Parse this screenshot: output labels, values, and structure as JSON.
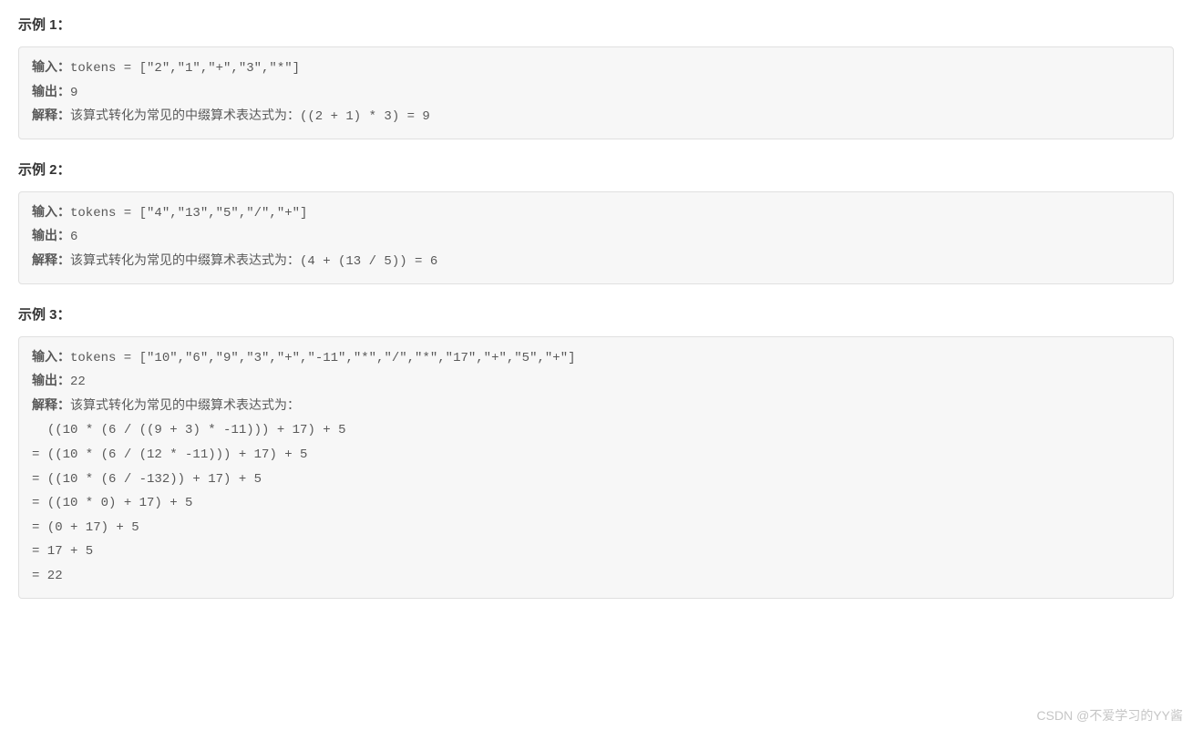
{
  "examples": [
    {
      "title": "示例 1：",
      "input_label": "输入：",
      "input_value": "tokens = [\"2\",\"1\",\"+\",\"3\",\"*\"]",
      "output_label": "输出：",
      "output_value": "9",
      "explain_label": "解释：",
      "explain_first": "该算式转化为常见的中缀算术表达式为：((2 + 1) * 3) = 9",
      "extra_lines": []
    },
    {
      "title": "示例 2：",
      "input_label": "输入：",
      "input_value": "tokens = [\"4\",\"13\",\"5\",\"/\",\"+\"]",
      "output_label": "输出：",
      "output_value": "6",
      "explain_label": "解释：",
      "explain_first": "该算式转化为常见的中缀算术表达式为：(4 + (13 / 5)) = 6",
      "extra_lines": []
    },
    {
      "title": "示例 3：",
      "input_label": "输入：",
      "input_value": "tokens = [\"10\",\"6\",\"9\",\"3\",\"+\",\"-11\",\"*\",\"/\",\"*\",\"17\",\"+\",\"5\",\"+\"]",
      "output_label": "输出：",
      "output_value": "22",
      "explain_label": "解释：",
      "explain_first": "该算式转化为常见的中缀算术表达式为：",
      "extra_lines": [
        "  ((10 * (6 / ((9 + 3) * -11))) + 17) + 5",
        "= ((10 * (6 / (12 * -11))) + 17) + 5",
        "= ((10 * (6 / -132)) + 17) + 5",
        "= ((10 * 0) + 17) + 5",
        "= (0 + 17) + 5",
        "= 17 + 5",
        "= 22"
      ]
    }
  ],
  "watermark": "CSDN @不爱学习的YY酱"
}
